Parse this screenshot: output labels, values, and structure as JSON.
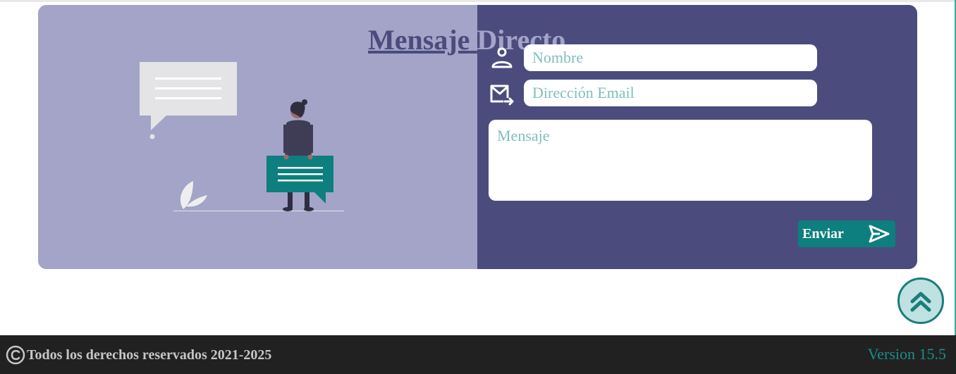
{
  "contact": {
    "title_part1": "Mensaje",
    "title_part2": "Directo...",
    "name_placeholder": "Nombre",
    "email_placeholder": "Dirección Email",
    "message_placeholder": "Mensaje",
    "send_label": "Enviar"
  },
  "icons": {
    "name_field": "user-icon",
    "email_field": "mail-forward-icon",
    "send": "send-icon",
    "scroll_top": "double-chevron-up-icon",
    "copyright": "copyright-icon"
  },
  "footer": {
    "copyright_text": "Todos los derechos reservados 2021-2025",
    "version": "Version 15.5"
  },
  "colors": {
    "card_left": "#a3a4c8",
    "card_right": "#4b4c7d",
    "accent": "#0c7f7e",
    "footer_bg": "#212121",
    "placeholder": "#7fbfbd"
  }
}
